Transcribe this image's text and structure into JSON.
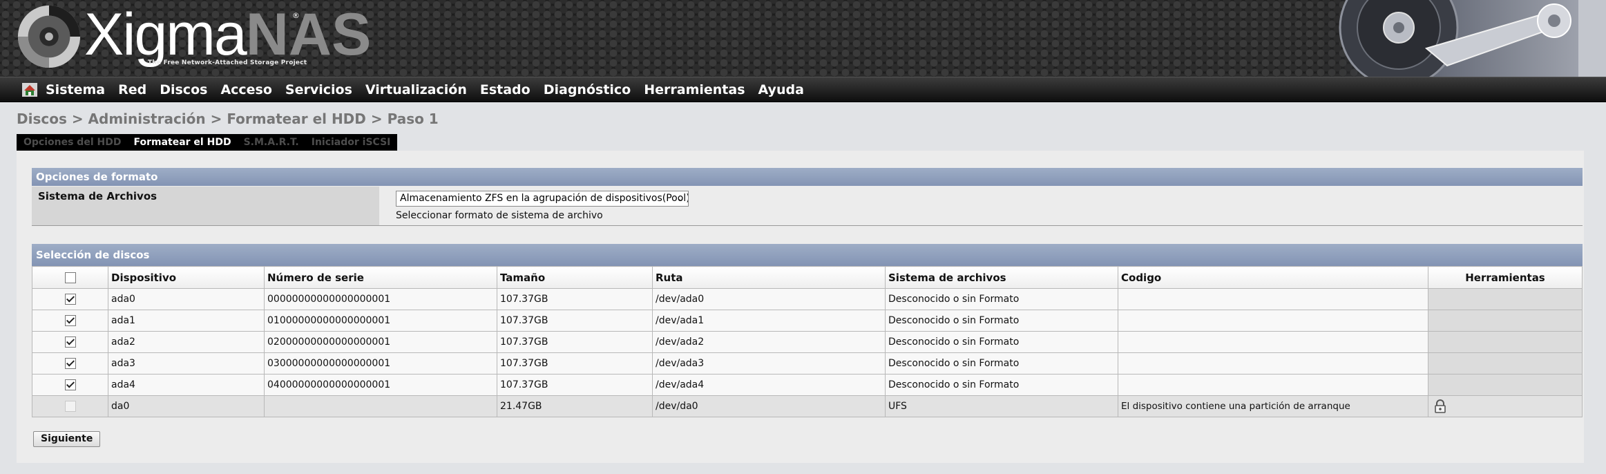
{
  "header": {
    "logo_main": "Xigma",
    "logo_accent": "NAS",
    "logo_tm": "®",
    "tagline": "The Free Network-Attached Storage Project"
  },
  "menu": {
    "home_icon": "home-icon",
    "items": [
      "Sistema",
      "Red",
      "Discos",
      "Acceso",
      "Servicios",
      "Virtualización",
      "Estado",
      "Diagnóstico",
      "Herramientas",
      "Ayuda"
    ]
  },
  "breadcrumb": "Discos > Administración > Formatear el HDD > Paso 1",
  "tabs": [
    {
      "label": "Opciones del HDD",
      "active": false
    },
    {
      "label": "Formatear el HDD",
      "active": true
    },
    {
      "label": "S.M.A.R.T.",
      "active": false
    },
    {
      "label": "Iniciador iSCSI",
      "active": false
    }
  ],
  "format_options": {
    "title": "Opciones de formato",
    "fs_label": "Sistema de Archivos",
    "fs_value": "Almacenamiento ZFS en la agrupación de dispositivos(Pool).",
    "fs_desc": "Seleccionar formato de sistema de archivo"
  },
  "disk_selection": {
    "title": "Selección de discos",
    "headers": [
      "Dispositivo",
      "Número de serie",
      "Tamaño",
      "Ruta",
      "Sistema de archivos",
      "Codigo",
      "Herramientas"
    ],
    "rows": [
      {
        "device": "ada0",
        "serial": "00000000000000000001",
        "size": "107.37GB",
        "path": "/dev/ada0",
        "fs": "Desconocido o sin Formato",
        "code": "",
        "checked": true,
        "disabled": false
      },
      {
        "device": "ada1",
        "serial": "01000000000000000001",
        "size": "107.37GB",
        "path": "/dev/ada1",
        "fs": "Desconocido o sin Formato",
        "code": "",
        "checked": true,
        "disabled": false
      },
      {
        "device": "ada2",
        "serial": "02000000000000000001",
        "size": "107.37GB",
        "path": "/dev/ada2",
        "fs": "Desconocido o sin Formato",
        "code": "",
        "checked": true,
        "disabled": false
      },
      {
        "device": "ada3",
        "serial": "03000000000000000001",
        "size": "107.37GB",
        "path": "/dev/ada3",
        "fs": "Desconocido o sin Formato",
        "code": "",
        "checked": true,
        "disabled": false
      },
      {
        "device": "ada4",
        "serial": "04000000000000000001",
        "size": "107.37GB",
        "path": "/dev/ada4",
        "fs": "Desconocido o sin Formato",
        "code": "",
        "checked": true,
        "disabled": false
      },
      {
        "device": "da0",
        "serial": "",
        "size": "21.47GB",
        "path": "/dev/da0",
        "fs": "UFS",
        "code": "El dispositivo contiene una partición de arranque",
        "checked": false,
        "disabled": true,
        "tool_icon": "lock-icon"
      }
    ]
  },
  "buttons": {
    "next": "Siguiente"
  }
}
